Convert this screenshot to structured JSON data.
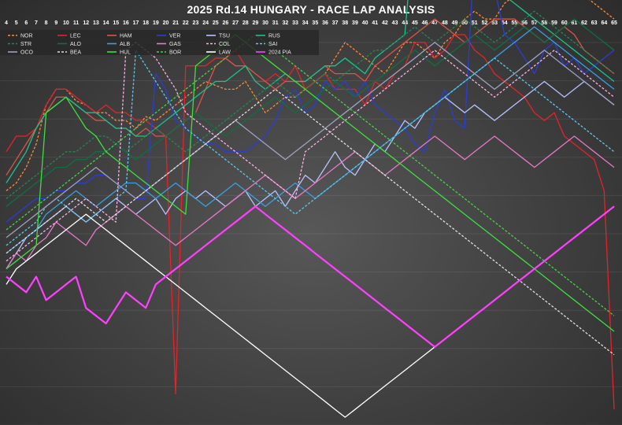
{
  "chart_data": {
    "type": "line",
    "title": "2025 Rd.14 HUNGARY - RACE LAP ANALYSIS",
    "xlabel": "",
    "ylabel": "",
    "x_tick_labels": [
      "4",
      "5",
      "6",
      "7",
      "8",
      "9",
      "10",
      "11",
      "12",
      "13",
      "14",
      "15",
      "16",
      "17",
      "18",
      "19",
      "20",
      "21",
      "22",
      "23",
      "24",
      "25",
      "26",
      "27",
      "28",
      "29",
      "30",
      "31",
      "32",
      "33",
      "34",
      "35",
      "36",
      "37",
      "38",
      "39",
      "40",
      "41",
      "42",
      "43",
      "44",
      "45",
      "46",
      "47",
      "48",
      "49",
      "50",
      "51",
      "52",
      "53",
      "54",
      "55",
      "56",
      "57",
      "58",
      "59",
      "60",
      "61",
      "62",
      "63",
      "64",
      "65"
    ],
    "xlim": [
      4,
      65
    ],
    "ylim": [
      0,
      100
    ],
    "grid": true,
    "legend_position": "top-left",
    "series": [
      {
        "name": "NOR",
        "color": "#ff8a3a",
        "dash": true,
        "values": [
          60,
          62,
          66,
          72,
          82,
          86,
          86,
          83,
          82,
          80,
          80,
          78,
          78,
          76,
          79,
          78,
          80,
          82,
          84,
          86,
          88,
          87,
          86,
          86,
          88,
          84,
          80,
          82,
          84,
          84,
          86,
          88,
          90,
          94,
          98,
          96,
          94,
          92,
          90,
          94,
          98,
          98,
          96,
          94,
          98,
          100,
          104,
          106,
          104,
          104,
          108,
          110,
          110,
          110,
          112,
          114,
          114,
          112,
          110,
          108,
          106,
          104
        ]
      },
      {
        "name": "LEC",
        "color": "#e8212b",
        "dash": false,
        "values": [
          70,
          74,
          74,
          76,
          82,
          86,
          86,
          84,
          82,
          80,
          82,
          80,
          80,
          78,
          78,
          76,
          74,
          8,
          92,
          92,
          92,
          94,
          94,
          96,
          92,
          88,
          88,
          90,
          88,
          92,
          86,
          88,
          90,
          86,
          86,
          86,
          82,
          88,
          86,
          90,
          92,
          98,
          98,
          94,
          96,
          100,
          100,
          96,
          94,
          90,
          88,
          86,
          84,
          80,
          78,
          80,
          74,
          72,
          70,
          68,
          60,
          4
        ]
      },
      {
        "name": "HAM",
        "color": "#e25247",
        "dash": false,
        "values": [
          64,
          68,
          72,
          76,
          80,
          84,
          84,
          82,
          80,
          78,
          78,
          76,
          76,
          74,
          76,
          74,
          74,
          76,
          78,
          80,
          86,
          92,
          94,
          92,
          92,
          90,
          88,
          86,
          88,
          88,
          88,
          90,
          92,
          90,
          90,
          90,
          88,
          92,
          94,
          96,
          98,
          100,
          102,
          104,
          102,
          100,
          98,
          100,
          102,
          104,
          104,
          104,
          102,
          100,
          98,
          100,
          102,
          100,
          96,
          94,
          92,
          90
        ]
      },
      {
        "name": "VER",
        "color": "#2a3dd6",
        "dash": false,
        "values": [
          52,
          54,
          56,
          58,
          58,
          60,
          60,
          62,
          62,
          64,
          64,
          62,
          60,
          58,
          58,
          90,
          86,
          78,
          76,
          74,
          72,
          72,
          70,
          70,
          70,
          72,
          74,
          78,
          84,
          86,
          80,
          82,
          88,
          86,
          88,
          84,
          88,
          82,
          80,
          78,
          76,
          72,
          70,
          80,
          86,
          78,
          76,
          122,
          118,
          112,
          100,
          98,
          94,
          90,
          96,
          98,
          92,
          94,
          90,
          92,
          94,
          96
        ]
      },
      {
        "name": "TSU",
        "color": "#b8c2ff",
        "dash": false,
        "values": [
          40,
          44,
          48,
          50,
          52,
          54,
          56,
          54,
          52,
          54,
          56,
          58,
          56,
          54,
          56,
          58,
          54,
          58,
          60,
          58,
          60,
          58,
          56,
          58,
          60,
          56,
          58,
          60,
          56,
          60,
          64,
          62,
          66,
          70,
          66,
          64,
          68,
          72,
          70,
          74,
          78,
          76,
          80,
          82,
          84,
          82,
          80,
          82,
          80,
          78,
          80,
          82,
          84,
          86,
          88,
          86,
          84,
          86,
          88,
          86,
          84,
          82
        ]
      },
      {
        "name": "RUS",
        "color": "#19c48a",
        "dash": false,
        "values": [
          62,
          66,
          70,
          76,
          80,
          82,
          84,
          82,
          80,
          80,
          78,
          76,
          76,
          74,
          74,
          76,
          78,
          80,
          82,
          84,
          86,
          88,
          88,
          90,
          92,
          88,
          86,
          88,
          90,
          88,
          88,
          90,
          92,
          92,
          94,
          92,
          90,
          94,
          96,
          98,
          100,
          130,
          128,
          126,
          124,
          120,
          118,
          116,
          114,
          112,
          110,
          108,
          106,
          104,
          102,
          100,
          98,
          96,
          94,
          92,
          90,
          88
        ]
      },
      {
        "name": "STR",
        "color": "#1f8a52",
        "dash": true,
        "values": [
          58,
          60,
          62,
          64,
          66,
          68,
          70,
          70,
          72,
          74,
          74,
          72,
          70,
          72,
          74,
          76,
          74,
          72,
          70,
          72,
          74,
          76,
          78,
          80,
          82,
          84,
          86,
          88,
          86,
          84,
          86,
          88,
          90,
          88,
          90,
          92,
          94,
          96,
          96,
          98,
          100,
          102,
          100,
          98,
          100,
          102,
          104,
          102,
          100,
          98,
          100,
          102,
          104,
          106,
          104,
          102,
          100,
          98,
          96,
          94,
          92,
          90
        ]
      },
      {
        "name": "ALO",
        "color": "#0d7040",
        "dash": false,
        "values": [
          56,
          58,
          60,
          62,
          64,
          66,
          66,
          68,
          68,
          70,
          70,
          72,
          70,
          68,
          70,
          72,
          74,
          76,
          78,
          80,
          78,
          76,
          74,
          76,
          78,
          80,
          82,
          84,
          82,
          80,
          82,
          84,
          86,
          88,
          86,
          84,
          86,
          88,
          90,
          92,
          94,
          96,
          94,
          92,
          94,
          96,
          98,
          100,
          98,
          96,
          98,
          100,
          102,
          100,
          98,
          100,
          102,
          104,
          102,
          100,
          98,
          96
        ]
      },
      {
        "name": "ALB",
        "color": "#3a9fe0",
        "dash": false,
        "values": [
          44,
          46,
          48,
          50,
          54,
          56,
          58,
          60,
          58,
          56,
          58,
          60,
          62,
          62,
          60,
          58,
          60,
          62,
          60,
          58,
          56,
          58,
          60,
          62,
          60,
          58,
          56,
          58,
          60,
          62,
          60,
          58,
          60,
          62,
          64,
          66,
          68,
          70,
          72,
          74,
          76,
          78,
          80,
          82,
          84,
          86,
          88,
          90,
          92,
          94,
          96,
          98,
          100,
          102,
          100,
          98,
          96,
          94,
          92,
          90,
          88,
          86
        ]
      },
      {
        "name": "GAS",
        "color": "#e878c8",
        "dash": false,
        "values": [
          40,
          44,
          42,
          46,
          48,
          52,
          50,
          48,
          46,
          50,
          52,
          54,
          56,
          54,
          52,
          50,
          48,
          46,
          48,
          50,
          52,
          54,
          56,
          58,
          60,
          62,
          64,
          62,
          60,
          58,
          60,
          62,
          64,
          66,
          68,
          70,
          68,
          66,
          64,
          66,
          68,
          70,
          72,
          74,
          72,
          70,
          68,
          70,
          72,
          74,
          72,
          70,
          68,
          66,
          68,
          70,
          72,
          74,
          72,
          70,
          68,
          66
        ]
      },
      {
        "name": "COL",
        "color": "#ffb0e8",
        "dash": true,
        "values": [
          42,
          44,
          46,
          48,
          50,
          52,
          54,
          56,
          58,
          56,
          54,
          52,
          96,
          98,
          96,
          94,
          90,
          86,
          80,
          78,
          76,
          74,
          72,
          70,
          68,
          66,
          64,
          62,
          60,
          58,
          70,
          72,
          74,
          76,
          78,
          80,
          82,
          84,
          86,
          88,
          90,
          92,
          94,
          96,
          94,
          92,
          90,
          88,
          86,
          84,
          86,
          88,
          90,
          92,
          94,
          96,
          94,
          92,
          90,
          88,
          86,
          84
        ]
      },
      {
        "name": "SAI",
        "color": "#5ac8f0",
        "dash": true,
        "values": [
          46,
          48,
          50,
          52,
          56,
          58,
          56,
          54,
          52,
          54,
          56,
          58,
          60,
          96,
          92,
          88,
          84,
          80,
          76,
          74,
          72,
          70,
          68,
          66,
          64,
          62,
          60,
          58,
          56,
          54,
          56,
          58,
          60,
          62,
          64,
          66,
          68,
          70,
          72,
          74,
          76,
          78,
          80,
          82,
          84,
          86,
          88,
          90,
          92,
          94,
          92,
          90,
          88,
          86,
          84,
          82,
          80,
          78,
          76,
          74,
          72,
          70
        ]
      },
      {
        "name": "OCO",
        "color": "#a0a0c0",
        "dash": false,
        "values": [
          48,
          50,
          52,
          54,
          56,
          58,
          60,
          62,
          64,
          66,
          64,
          62,
          60,
          58,
          60,
          62,
          64,
          66,
          68,
          70,
          72,
          74,
          76,
          78,
          76,
          74,
          72,
          70,
          68,
          70,
          72,
          74,
          76,
          78,
          80,
          82,
          84,
          86,
          88,
          90,
          92,
          94,
          96,
          98,
          96,
          94,
          92,
          90,
          88,
          86,
          88,
          90,
          92,
          94,
          96,
          94,
          92,
          90,
          88,
          86,
          84,
          82
        ]
      },
      {
        "name": "BEA",
        "color": "#e0e0e0",
        "dash": true,
        "values": [
          44,
          46,
          48,
          50,
          52,
          54,
          56,
          58,
          56,
          54,
          52,
          54,
          56,
          58,
          60,
          62,
          64,
          66,
          68,
          70,
          72,
          74,
          76,
          78,
          80,
          82,
          84,
          86,
          84,
          82,
          80,
          78,
          76,
          74,
          72,
          70,
          68,
          66,
          64,
          62,
          60,
          58,
          56,
          54,
          52,
          50,
          48,
          46,
          44,
          42,
          40,
          38,
          36,
          34,
          32,
          30,
          28,
          26,
          24,
          22,
          20,
          18
        ]
      },
      {
        "name": "HUL",
        "color": "#3ce03c",
        "dash": false,
        "values": [
          40,
          42,
          44,
          46,
          80,
          82,
          84,
          80,
          76,
          74,
          70,
          68,
          66,
          64,
          62,
          60,
          58,
          56,
          54,
          92,
          94,
          96,
          98,
          100,
          98,
          96,
          94,
          92,
          90,
          88,
          86,
          84,
          82,
          80,
          78,
          76,
          74,
          72,
          70,
          68,
          66,
          64,
          62,
          60,
          58,
          56,
          54,
          52,
          50,
          48,
          46,
          44,
          42,
          40,
          38,
          36,
          34,
          32,
          30,
          28,
          26,
          24
        ]
      },
      {
        "name": "BOR",
        "color": "#4ad04a",
        "dash": true,
        "values": [
          50,
          52,
          54,
          56,
          58,
          60,
          62,
          64,
          66,
          68,
          70,
          72,
          74,
          76,
          78,
          80,
          82,
          84,
          86,
          88,
          90,
          92,
          94,
          96,
          98,
          100,
          98,
          96,
          94,
          92,
          90,
          88,
          86,
          84,
          82,
          80,
          78,
          76,
          74,
          72,
          70,
          68,
          66,
          64,
          62,
          60,
          58,
          56,
          54,
          52,
          50,
          48,
          46,
          44,
          42,
          40,
          38,
          36,
          34,
          32,
          30,
          28
        ]
      },
      {
        "name": "LAW",
        "color": "#ffffff",
        "dash": false,
        "values": [
          36,
          40,
          42,
          44,
          46,
          48,
          50,
          52,
          54,
          52,
          50,
          48,
          46,
          44,
          42,
          40,
          38,
          36,
          34,
          32,
          30,
          28,
          26,
          24,
          22,
          20,
          18,
          16,
          14,
          12,
          10,
          8,
          6,
          4,
          2,
          4,
          6,
          8,
          10,
          12,
          14,
          16,
          18,
          20,
          22,
          24,
          26,
          28,
          30,
          32,
          34,
          36,
          38,
          40,
          42,
          44,
          46,
          48,
          50,
          52,
          54,
          56
        ]
      },
      {
        "name": "2024 PIA",
        "color": "#ff40ff",
        "dash": false,
        "values": [
          38,
          36,
          34,
          38,
          32,
          34,
          36,
          38,
          30,
          28,
          26,
          30,
          34,
          32,
          30,
          36,
          38,
          40,
          42,
          44,
          46,
          48,
          50,
          52,
          54,
          56,
          54,
          52,
          50,
          48,
          46,
          44,
          42,
          40,
          38,
          36,
          34,
          32,
          30,
          28,
          26,
          24,
          22,
          20,
          22,
          24,
          26,
          28,
          30,
          32,
          34,
          36,
          38,
          40,
          42,
          44,
          46,
          48,
          50,
          52,
          54,
          56
        ]
      }
    ]
  }
}
